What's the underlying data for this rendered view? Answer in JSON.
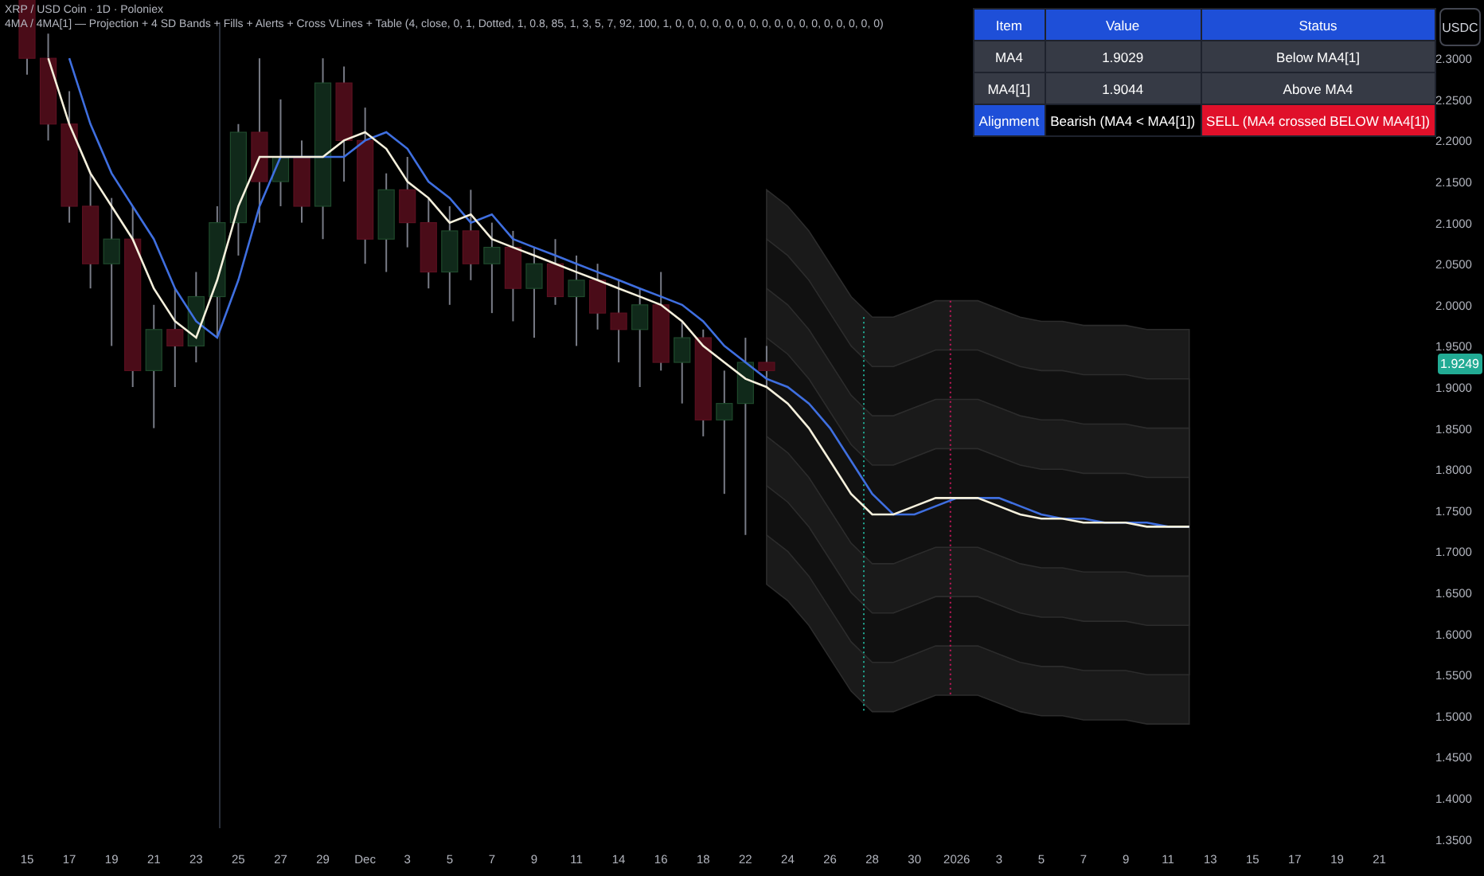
{
  "legend": {
    "symbol": "XRP / USD Coin · 1D · Poloniex",
    "indicator": "4MA / 4MA[1] — Projection + 4 SD Bands + Fills + Alerts + Cross VLines + Table (4, close, 0, 1, Dotted, 1, 0.8, 85, 1, 3, 5, 7, 92, 100, 1, 0, 0, 0, 0, 0, 0, 0, 0, 0, 0, 0, 0, 0, 0, 0, 0, 0)"
  },
  "currency_button": "USDC",
  "current_price": "1.9249",
  "table": {
    "rows": [
      {
        "cells": [
          {
            "text": "Item",
            "color": "#1e4fd8"
          },
          {
            "text": "Value",
            "color": "#1e4fd8"
          },
          {
            "text": "Status",
            "color": "#1e4fd8"
          }
        ]
      },
      {
        "cells": [
          {
            "text": "MA4",
            "color": "#363a45"
          },
          {
            "text": "1.9029",
            "color": "#363a45"
          },
          {
            "text": "Below MA4[1]",
            "color": "#363a45"
          }
        ]
      },
      {
        "cells": [
          {
            "text": "MA4[1]",
            "color": "#363a45"
          },
          {
            "text": "1.9044",
            "color": "#363a45"
          },
          {
            "text": "Above MA4",
            "color": "#363a45"
          }
        ]
      },
      {
        "cells": [
          {
            "text": "Alignment",
            "color": "#1e4fd8"
          },
          {
            "text": "Bearish (MA4 < MA4[1])",
            "color": "#000000"
          },
          {
            "text": "SELL (MA4 crossed BELOW MA4[1])",
            "color": "#e0102a"
          }
        ]
      }
    ]
  },
  "chart_data": {
    "type": "candlestick",
    "categories": [
      "15",
      null,
      "17",
      null,
      "19",
      null,
      "21",
      null,
      "23",
      null,
      "25",
      null,
      "27",
      null,
      "29",
      null,
      "Dec",
      null,
      "3",
      null,
      "5",
      null,
      "7",
      null,
      "9",
      null,
      "11",
      null,
      "14",
      null,
      "16",
      null,
      "18",
      null,
      "22",
      null,
      "24",
      null,
      "26",
      null,
      "28",
      null,
      "30",
      null,
      "2026",
      null,
      "3",
      null,
      "5",
      null,
      "7",
      null,
      "9",
      null,
      "11",
      null,
      "13",
      null,
      "15",
      null,
      "17",
      null,
      "19",
      null,
      "21"
    ],
    "ohlc": [
      [
        2.38,
        2.4,
        2.28,
        2.3
      ],
      [
        2.3,
        2.33,
        2.2,
        2.22
      ],
      [
        2.22,
        2.26,
        2.1,
        2.12
      ],
      [
        2.12,
        2.16,
        2.02,
        2.05
      ],
      [
        2.05,
        2.13,
        1.95,
        2.08
      ],
      [
        2.08,
        2.12,
        1.9,
        1.92
      ],
      [
        1.92,
        2.0,
        1.85,
        1.97
      ],
      [
        1.97,
        2.02,
        1.9,
        1.95
      ],
      [
        1.95,
        2.04,
        1.93,
        2.01
      ],
      [
        2.01,
        2.12,
        1.96,
        2.1
      ],
      [
        2.1,
        2.22,
        2.06,
        2.21
      ],
      [
        2.21,
        2.3,
        2.1,
        2.15
      ],
      [
        2.15,
        2.25,
        2.12,
        2.18
      ],
      [
        2.18,
        2.2,
        2.1,
        2.12
      ],
      [
        2.12,
        2.3,
        2.08,
        2.27
      ],
      [
        2.27,
        2.29,
        2.15,
        2.2
      ],
      [
        2.2,
        2.24,
        2.05,
        2.08
      ],
      [
        2.08,
        2.16,
        2.04,
        2.14
      ],
      [
        2.14,
        2.18,
        2.07,
        2.1
      ],
      [
        2.1,
        2.13,
        2.02,
        2.04
      ],
      [
        2.04,
        2.12,
        2.0,
        2.09
      ],
      [
        2.09,
        2.14,
        2.03,
        2.05
      ],
      [
        2.05,
        2.1,
        1.99,
        2.07
      ],
      [
        2.07,
        2.09,
        1.98,
        2.02
      ],
      [
        2.02,
        2.07,
        1.96,
        2.05
      ],
      [
        2.05,
        2.08,
        2.0,
        2.01
      ],
      [
        2.01,
        2.06,
        1.95,
        2.03
      ],
      [
        2.03,
        2.05,
        1.97,
        1.99
      ],
      [
        1.99,
        2.03,
        1.93,
        1.97
      ],
      [
        1.97,
        2.02,
        1.9,
        2.0
      ],
      [
        2.0,
        2.04,
        1.92,
        1.93
      ],
      [
        1.93,
        1.98,
        1.88,
        1.96
      ],
      [
        1.96,
        1.97,
        1.84,
        1.86
      ],
      [
        1.86,
        1.92,
        1.77,
        1.88
      ],
      [
        1.88,
        1.96,
        1.72,
        1.93
      ],
      [
        1.93,
        1.95,
        1.9,
        1.92
      ],
      null,
      null,
      null,
      null,
      null,
      null,
      null,
      null,
      null,
      null,
      null,
      null,
      null,
      null,
      null,
      null,
      null,
      null,
      null,
      null,
      null,
      null,
      null,
      null,
      null,
      null,
      null,
      null,
      null
    ],
    "series": [
      {
        "type": "line",
        "color": "#f5f0dc",
        "values": [
          null,
          2.3,
          2.22,
          2.16,
          2.12,
          2.08,
          2.02,
          1.98,
          1.96,
          2.03,
          2.12,
          2.18,
          2.18,
          2.18,
          2.18,
          2.2,
          2.21,
          2.19,
          2.15,
          2.13,
          2.1,
          2.11,
          2.08,
          2.07,
          2.06,
          2.05,
          2.04,
          2.03,
          2.02,
          2.01,
          2.0,
          1.98,
          1.95,
          1.93,
          1.91,
          1.9,
          1.88,
          1.85,
          1.81,
          1.77,
          1.745,
          1.745,
          1.755,
          1.765,
          1.765,
          1.765,
          1.755,
          1.745,
          1.74,
          1.74,
          1.735,
          1.735,
          1.735,
          1.73,
          1.73,
          1.73,
          null,
          null,
          null,
          null,
          null,
          null,
          null,
          null,
          null
        ]
      },
      {
        "type": "line",
        "color": "#3f6fe0",
        "values": [
          null,
          null,
          2.3,
          2.22,
          2.16,
          2.12,
          2.08,
          2.02,
          1.98,
          1.96,
          2.03,
          2.12,
          2.18,
          2.18,
          2.18,
          2.18,
          2.2,
          2.21,
          2.19,
          2.15,
          2.13,
          2.1,
          2.11,
          2.08,
          2.07,
          2.06,
          2.05,
          2.04,
          2.03,
          2.02,
          2.01,
          2.0,
          1.98,
          1.95,
          1.93,
          1.91,
          1.9,
          1.88,
          1.85,
          1.81,
          1.77,
          1.745,
          1.745,
          1.755,
          1.765,
          1.765,
          1.765,
          1.755,
          1.745,
          1.74,
          1.74,
          1.735,
          1.735,
          1.735,
          1.73,
          1.73,
          null,
          null,
          null,
          null,
          null,
          null,
          null,
          null,
          null
        ]
      }
    ],
    "ylim": [
      1.35,
      2.3
    ],
    "yticks": [
      {
        "value": 2.3,
        "label": "2.3000"
      },
      {
        "value": 2.25,
        "label": "2.2500"
      },
      {
        "value": 2.2,
        "label": "2.2000"
      },
      {
        "value": 2.15,
        "label": "2.1500"
      },
      {
        "value": 2.1,
        "label": "2.1000"
      },
      {
        "value": 2.05,
        "label": "2.0500"
      },
      {
        "value": 2.0,
        "label": "2.0000"
      },
      {
        "value": 1.95,
        "label": "1.9500"
      },
      {
        "value": 1.9,
        "label": "1.9000"
      },
      {
        "value": 1.85,
        "label": "1.8500"
      },
      {
        "value": 1.8,
        "label": "1.8000"
      },
      {
        "value": 1.75,
        "label": "1.7500"
      },
      {
        "value": 1.7,
        "label": "1.7000"
      },
      {
        "value": 1.65,
        "label": "1.6500"
      },
      {
        "value": 1.6,
        "label": "1.6000"
      },
      {
        "value": 1.55,
        "label": "1.5500"
      },
      {
        "value": 1.5,
        "label": "1.5000"
      },
      {
        "value": 1.45,
        "label": "1.4500"
      },
      {
        "value": 1.4,
        "label": "1.4000"
      },
      {
        "value": 1.35,
        "label": "1.3500"
      }
    ]
  }
}
